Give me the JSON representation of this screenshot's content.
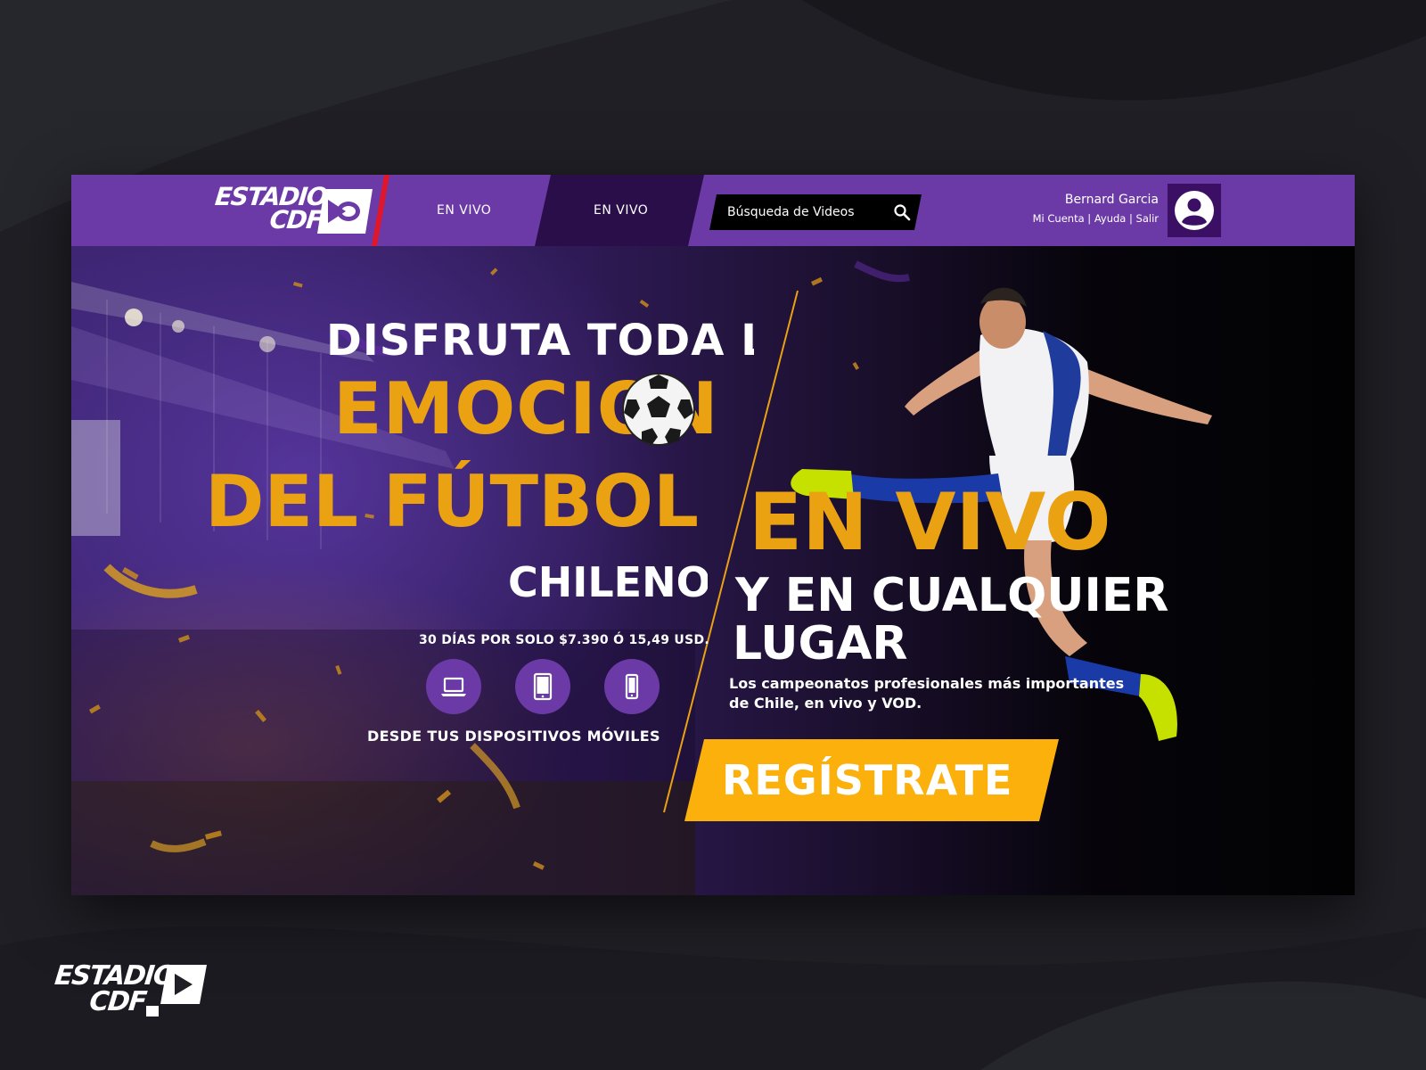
{
  "brand": {
    "logo_line1": "ESTADIO",
    "logo_line2": "CDF"
  },
  "nav": {
    "tab1": "EN VIVO",
    "tab2": "EN VIVO"
  },
  "search": {
    "placeholder": "Búsqueda de Videos"
  },
  "user": {
    "name": "Bernard Garcia",
    "links": [
      "Mi Cuenta",
      "Ayuda",
      "Salir"
    ],
    "separator": " | "
  },
  "hero": {
    "line1": "DISFRUTA TODA LA",
    "line2": "EMOCION",
    "line3": "DEL FÚTBOL",
    "line4": "CHILENO",
    "price": "30 DÍAS POR SOLO $7.390 Ó 15,49 USD.",
    "devices_label": "DESDE TUS DISPOSITIVOS MÓVILES",
    "devices": [
      "laptop-icon",
      "tablet-icon",
      "phone-icon"
    ],
    "en_vivo": "EN VIVO",
    "cualquier": "Y EN CUALQUIER",
    "lugar": "LUGAR",
    "description": "Los campeonatos profesionales más importantes de Chile, en vivo y VOD.",
    "cta": "REGÍSTRATE"
  },
  "colors": {
    "brand_purple": "#6c3aa6",
    "dark_purple": "#2a0e4a",
    "accent_yellow": "#fbb00c",
    "headline_orange": "#eaa112",
    "red_accent": "#e0162b"
  }
}
